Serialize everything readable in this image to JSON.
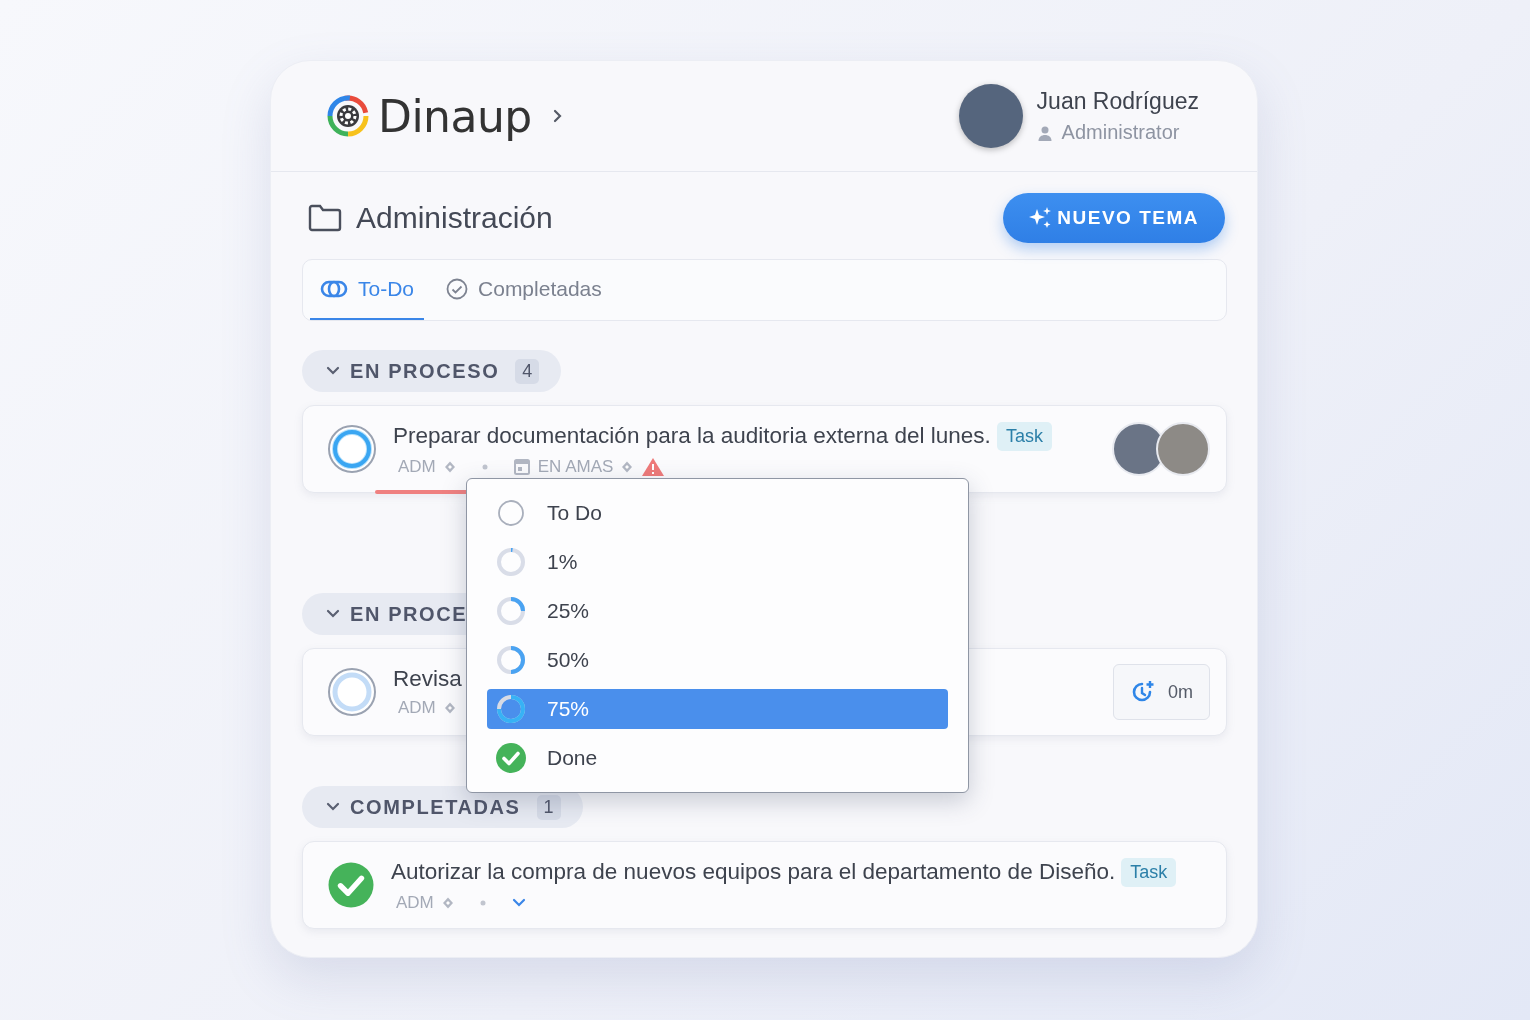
{
  "app": {
    "name": "Dinaup"
  },
  "user": {
    "name": "Juan Rodríguez",
    "role": "Administrator"
  },
  "section": {
    "title": "Administración"
  },
  "new_button": {
    "label": "NUEVO TEMA"
  },
  "tabs": [
    {
      "label": "To-Do",
      "kind": "toggle",
      "selected": true
    },
    {
      "label": "Completadas",
      "kind": "check",
      "selected": false
    }
  ],
  "groups": [
    {
      "label": "EN PROCESO",
      "count": "4",
      "expanded": true,
      "tasks": [
        {
          "kind": "in_progress",
          "title": "Preparar documentación para la auditoria externa del lunes.",
          "tag": "Task",
          "owner": "ADM",
          "list": "EN AMAS",
          "overdue": true,
          "assignees": [
            {
              "kind": "photo"
            },
            {
              "kind": "photo"
            }
          ]
        }
      ]
    },
    {
      "label": "EN PROCE",
      "expanded": true,
      "tasks": [
        {
          "kind": "pending",
          "title": "Revisa",
          "owner": "ADM",
          "timer": "0m"
        }
      ]
    },
    {
      "label": "COMPLETADAS",
      "count": "1",
      "expanded": true,
      "tasks": [
        {
          "kind": "done",
          "title": "Autorizar la compra de nuevos equipos para el departamento de Diseño.",
          "tag": "Task",
          "owner": "ADM",
          "expandable": true
        }
      ]
    }
  ],
  "status_menu": {
    "options": [
      {
        "label": "To Do",
        "kind": "empty",
        "selected": false
      },
      {
        "label": "1%",
        "kind": "sliver",
        "selected": false
      },
      {
        "label": "25%",
        "kind": "quarter",
        "selected": false
      },
      {
        "label": "50%",
        "kind": "half",
        "selected": false
      },
      {
        "label": "75%",
        "kind": "three_quarters",
        "selected": true
      },
      {
        "label": "Done",
        "kind": "done",
        "selected": false
      }
    ]
  }
}
